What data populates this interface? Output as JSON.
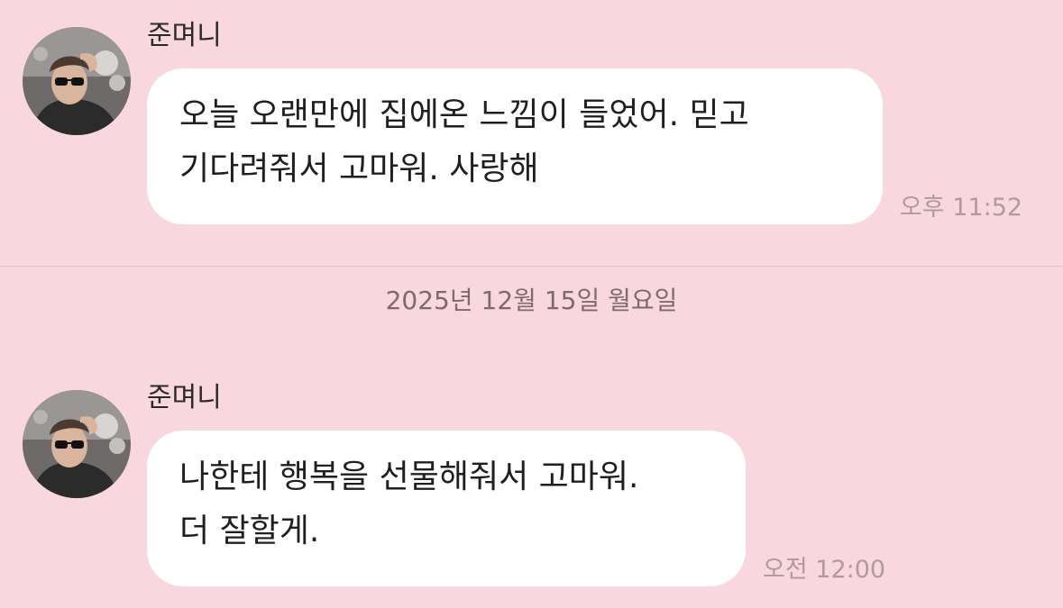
{
  "conversation": {
    "messages": [
      {
        "sender": "준며니",
        "lines": [
          "오늘 오랜만에 집에온 느낌이 들었어. 믿고",
          "기다려줘서 고마워. 사랑해"
        ],
        "time": "오후 11:52"
      },
      {
        "sender": "준며니",
        "lines": [
          "나한테 행복을 선물해줘서 고마워.",
          "더 잘할게."
        ],
        "time": "오전 12:00"
      }
    ],
    "date_separator": "2025년 12월 15일 월요일"
  },
  "colors": {
    "background": "#f9d7de",
    "bubble": "#ffffff",
    "timestamp": "#b09aa0"
  }
}
